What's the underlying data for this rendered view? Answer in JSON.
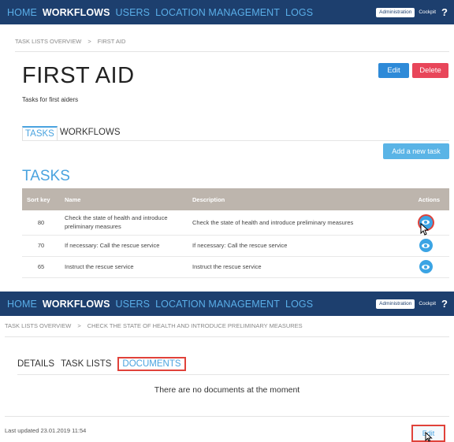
{
  "nav": {
    "items": [
      "HOME",
      "WORKFLOWS",
      "USERS",
      "LOCATION MANAGEMENT",
      "LOGS"
    ],
    "active": "WORKFLOWS",
    "admin_label": "Administration",
    "cockpit_label": "Cockpit",
    "help_label": "?"
  },
  "top": {
    "breadcrumb": [
      "TASK LISTS OVERVIEW",
      "FIRST AID"
    ],
    "breadcrumb_sep": ">",
    "title": "FIRST AID",
    "subtitle": "Tasks for first aiders",
    "edit_label": "Edit",
    "delete_label": "Delete",
    "tabs": [
      "TASKS",
      "WORKFLOWS"
    ],
    "active_tab": "TASKS",
    "add_task_label": "Add a new task",
    "section_title": "TASKS",
    "table": {
      "headers": [
        "Sort key",
        "Name",
        "Description",
        "Actions"
      ],
      "rows": [
        {
          "sort_key": "80",
          "name": "Check the state of health and introduce preliminary measures",
          "description": "Check the state of health and introduce preliminary measures"
        },
        {
          "sort_key": "70",
          "name": "If necessary: Call the rescue service",
          "description": "If necessary: Call the rescue service"
        },
        {
          "sort_key": "65",
          "name": "Instruct the rescue service",
          "description": "Instruct the rescue service"
        }
      ]
    }
  },
  "bottom": {
    "breadcrumb": [
      "TASK LISTS OVERVIEW",
      "CHECK THE STATE OF HEALTH AND INTRODUCE PRELIMINARY MEASURES"
    ],
    "breadcrumb_sep": ">",
    "tabs": [
      "DETAILS",
      "TASK LISTS",
      "DOCUMENTS"
    ],
    "active_tab": "DOCUMENTS",
    "empty_message": "There are no documents at the moment",
    "last_updated": "Last updated 23.01.2019 11:54",
    "edit_label": "Edit"
  },
  "colors": {
    "navbar": "#1d3f6e",
    "accent": "#4aa3df",
    "danger": "#e8465a",
    "highlight": "#e0423a"
  }
}
